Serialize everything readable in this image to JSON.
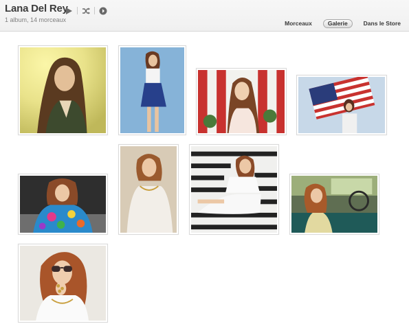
{
  "header": {
    "title": "Lana Del Rey",
    "subtitle": "1 album, 14 morceaux",
    "icons": [
      "play-icon",
      "shuffle-icon",
      "info-arrow-icon"
    ]
  },
  "tabs": [
    {
      "label": "Morceaux",
      "active": false
    },
    {
      "label": "Galerie",
      "active": true
    },
    {
      "label": "Dans le Store",
      "active": false
    }
  ],
  "gallery": {
    "photos": [
      {
        "name": "photo-yellow-sunset",
        "bg": "#e6e08a"
      },
      {
        "name": "photo-blue-skirt",
        "bg": "#8fb8d8"
      },
      {
        "name": "photo-red-stripes",
        "bg": "#c43a36"
      },
      {
        "name": "photo-american-flag",
        "bg": "#b8cde0"
      },
      {
        "name": "photo-colorful-shirt",
        "bg": "#3a3a3a"
      },
      {
        "name": "photo-white-sweater",
        "bg": "#d9cbb4"
      },
      {
        "name": "photo-striped-chair",
        "bg": "#3a3a3a"
      },
      {
        "name": "photo-vintage-car",
        "bg": "#6e7a5e"
      },
      {
        "name": "photo-sunglasses-rings",
        "bg": "#e8e4dc"
      }
    ]
  }
}
